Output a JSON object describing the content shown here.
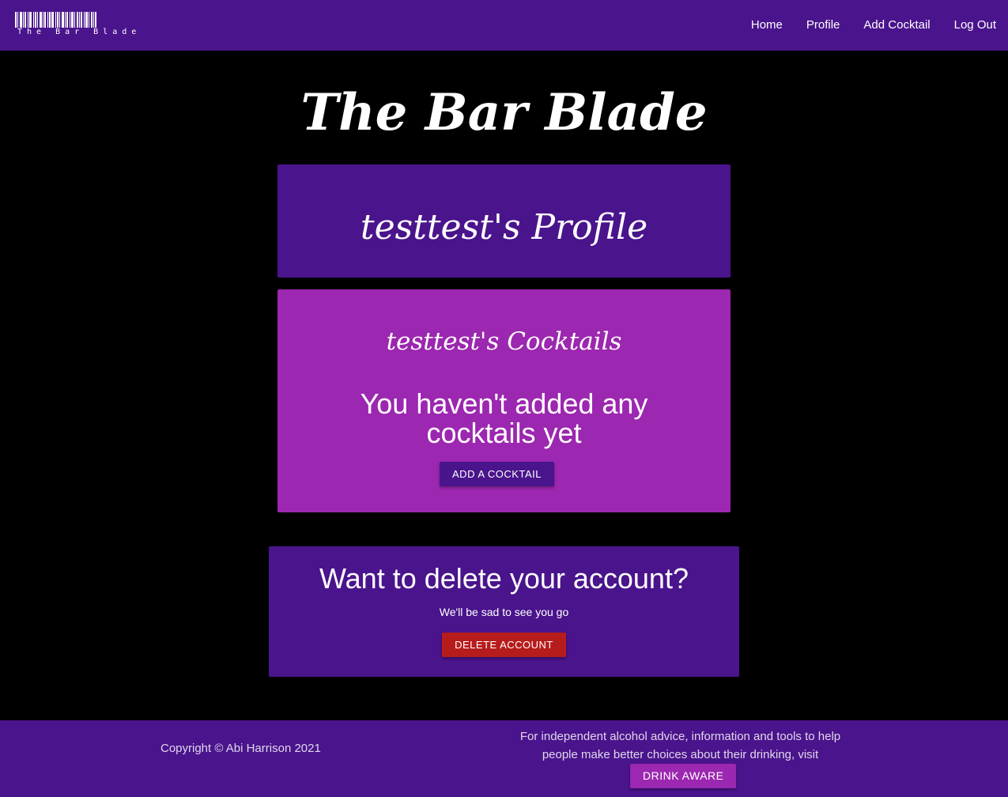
{
  "nav": {
    "brand": "The Bar Blade",
    "links": [
      "Home",
      "Profile",
      "Add Cocktail",
      "Log Out"
    ]
  },
  "site_title": "The Bar Blade",
  "profile": {
    "title": "testtest's Profile"
  },
  "cocktails": {
    "title": "testtest's Cocktails",
    "empty_message": "You haven't added any cocktails yet",
    "add_button": "Add a Cocktail"
  },
  "delete": {
    "title": "Want to delete your account?",
    "subtitle": "We'll be sad to see you go",
    "button": "Delete Account"
  },
  "footer": {
    "copyright": "Copyright © Abi Harrison 2021",
    "advice": "For independent alcohol advice, information and tools to help people make better choices about their drinking, visit",
    "drink_aware_button": "Drink Aware"
  },
  "colors": {
    "primary": "#4a148c",
    "accent": "#9c27b0",
    "danger": "#b71c1c",
    "background": "#000000"
  }
}
